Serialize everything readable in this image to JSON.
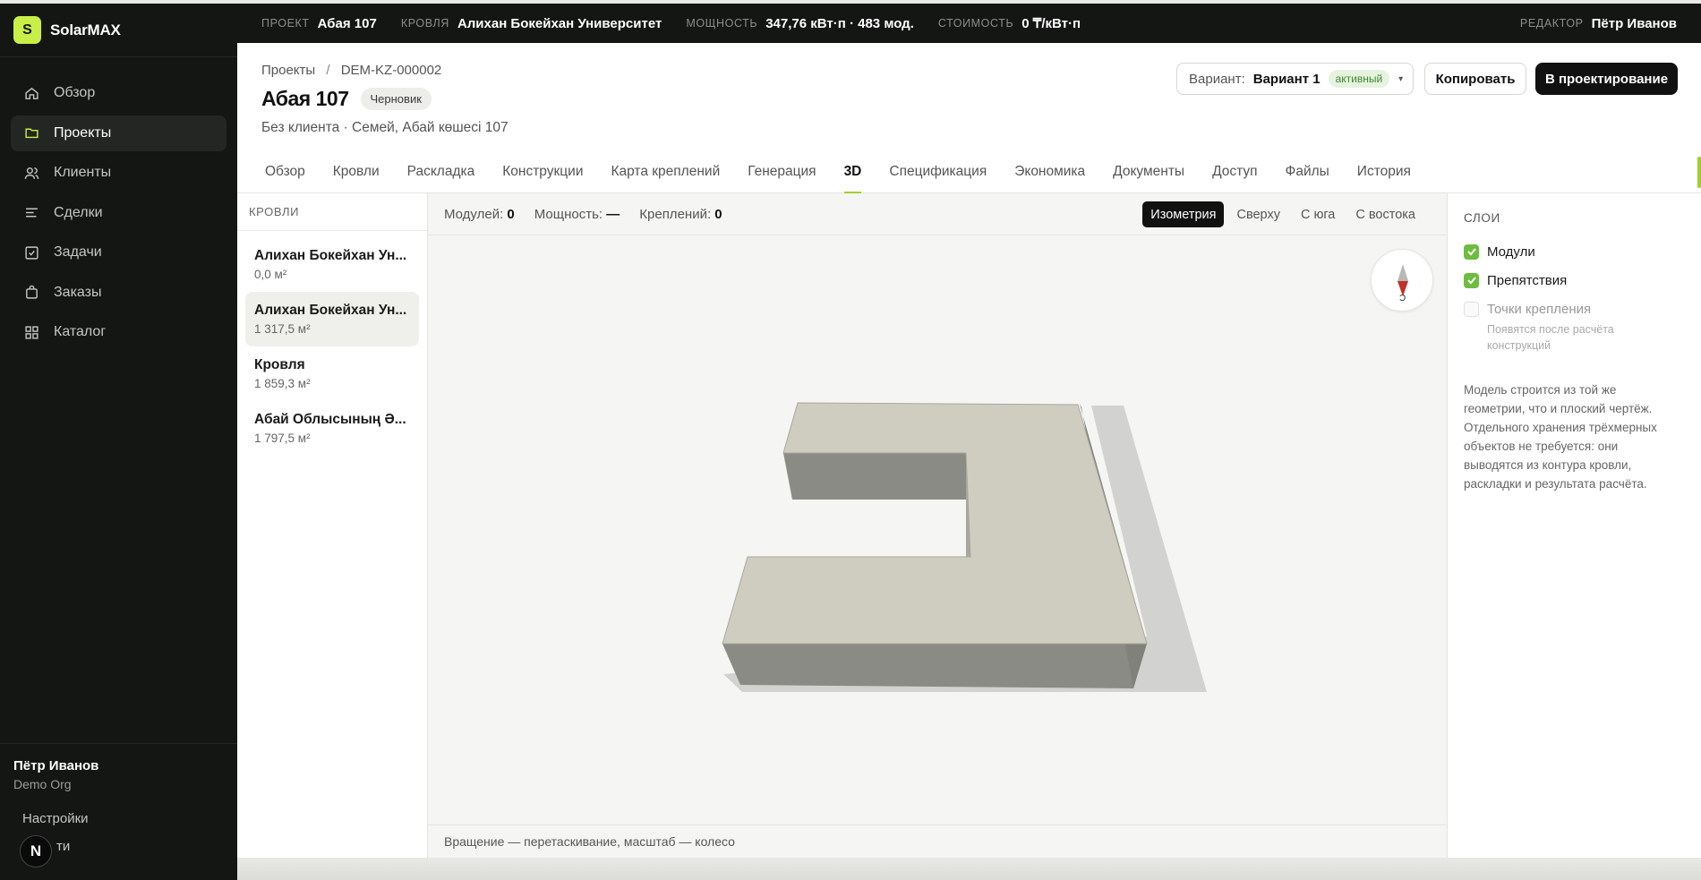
{
  "brand": {
    "logo_letter": "S",
    "name": "SolarMAX"
  },
  "sidebar": {
    "items": [
      {
        "label": "Обзор",
        "icon": "home-icon"
      },
      {
        "label": "Проекты",
        "icon": "folder-icon"
      },
      {
        "label": "Клиенты",
        "icon": "users-icon"
      },
      {
        "label": "Сделки",
        "icon": "deals-icon"
      },
      {
        "label": "Задачи",
        "icon": "checkbox-icon"
      },
      {
        "label": "Заказы",
        "icon": "bag-icon"
      },
      {
        "label": "Каталог",
        "icon": "grid-icon"
      }
    ],
    "user": {
      "name": "Пётр Иванов",
      "org": "Demo Org"
    },
    "settings_label": "Настройки",
    "logout_label": "ти",
    "badge_letter": "N"
  },
  "topbar": {
    "project_label": "ПРОЕКТ",
    "project": "Абая 107",
    "roof_label": "КРОВЛЯ",
    "roof": "Алихан Бокейхан Университет",
    "power_label": "МОЩНОСТЬ",
    "power": "347,76 кВт·п · 483 мод.",
    "cost_label": "СТОИМОСТЬ",
    "cost": "0 ₸/кВт·п",
    "editor_label": "РЕДАКТОР",
    "editor": "Пётр Иванов"
  },
  "header": {
    "breadcrumb": {
      "root": "Проекты",
      "separator": "/",
      "id": "DEM-KZ-000002"
    },
    "title": "Абая 107",
    "status": "Черновик",
    "subtitle": "Без клиента · Семей, Абай көшесі 107",
    "variant": {
      "label": "Вариант:",
      "value": "Вариант 1",
      "status": "активный",
      "caret": "▾"
    },
    "copy_button": "Копировать",
    "design_button": "В проектирование"
  },
  "tabs": [
    "Обзор",
    "Кровли",
    "Раскладка",
    "Конструкции",
    "Карта креплений",
    "Генерация",
    "3D",
    "Спецификация",
    "Экономика",
    "Документы",
    "Доступ",
    "Файлы",
    "История"
  ],
  "active_tab": "3D",
  "roofs": {
    "title": "КРОВЛИ",
    "items": [
      {
        "name": "Алихан Бокейхан Ун...",
        "area": "0,0 м²"
      },
      {
        "name": "Алихан Бокейхан Ун...",
        "area": "1 317,5 м²"
      },
      {
        "name": "Кровля",
        "area": "1 859,3 м²"
      },
      {
        "name": "Абай Облысының Ә...",
        "area": "1 797,5 м²"
      }
    ]
  },
  "viewer": {
    "modules_label": "Модулей:",
    "modules": "0",
    "power_label": "Мощность:",
    "power": "—",
    "fasteners_label": "Креплений:",
    "fasteners": "0",
    "views": [
      "Изометрия",
      "Сверху",
      "С юга",
      "С востока"
    ],
    "active_view": "Изометрия",
    "compass_letter": "С",
    "footer": "Вращение — перетаскивание, масштаб — колесо",
    "colors": {
      "roof_top": "#cfcdc0",
      "wall_dark": "#8a8b84",
      "shadow": "#d2d2d0"
    }
  },
  "layers": {
    "title": "СЛОИ",
    "items": [
      {
        "label": "Модули",
        "checked": true
      },
      {
        "label": "Препятствия",
        "checked": true
      },
      {
        "label": "Точки крепления",
        "checked": false
      }
    ],
    "fasteners_hint": "Появятся после расчёта конструкций",
    "note": "Модель строится из той же геометрии, что и плоский чертёж. Отдельного хранения трёхмерных объектов не требуется: они выводятся из контура кровли, раскладки и результата расчёта."
  },
  "colors": {
    "accent": "#c7ef48",
    "dark": "#141614",
    "check": "#6dbd3f"
  }
}
